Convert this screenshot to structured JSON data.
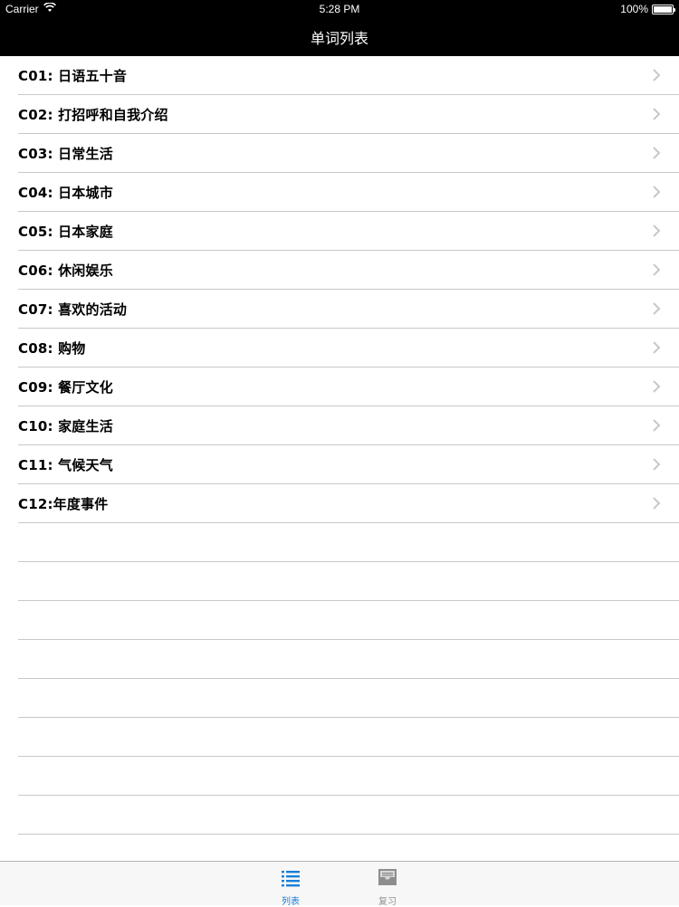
{
  "status_bar": {
    "carrier": "Carrier",
    "time": "5:28 PM",
    "battery": "100%",
    "wifi_icon": "wifi-icon",
    "battery_icon": "battery-icon"
  },
  "nav": {
    "title": "单词列表"
  },
  "list": {
    "items": [
      {
        "label": "C01: 日语五十音"
      },
      {
        "label": "C02: 打招呼和自我介绍"
      },
      {
        "label": "C03: 日常生活"
      },
      {
        "label": "C04: 日本城市"
      },
      {
        "label": "C05: 日本家庭"
      },
      {
        "label": "C06: 休闲娱乐"
      },
      {
        "label": "C07: 喜欢的活动"
      },
      {
        "label": "C08: 购物"
      },
      {
        "label": "C09: 餐厅文化"
      },
      {
        "label": "C10: 家庭生活"
      },
      {
        "label": "C11: 气候天气"
      },
      {
        "label": "C12:年度事件"
      }
    ],
    "accessory_icon": "chevron-right-icon"
  },
  "tab_bar": {
    "tabs": [
      {
        "label": "列表",
        "icon": "list-icon",
        "selected": true
      },
      {
        "label": "复习",
        "icon": "inbox-icon",
        "selected": false
      }
    ],
    "colors": {
      "selected": "#1a7fd6",
      "unselected": "#929292"
    }
  },
  "colors": {
    "nav_background": "#000000",
    "nav_text": "#ffffff",
    "separator": "#c8c7cc",
    "chevron": "#c7c7cc"
  }
}
